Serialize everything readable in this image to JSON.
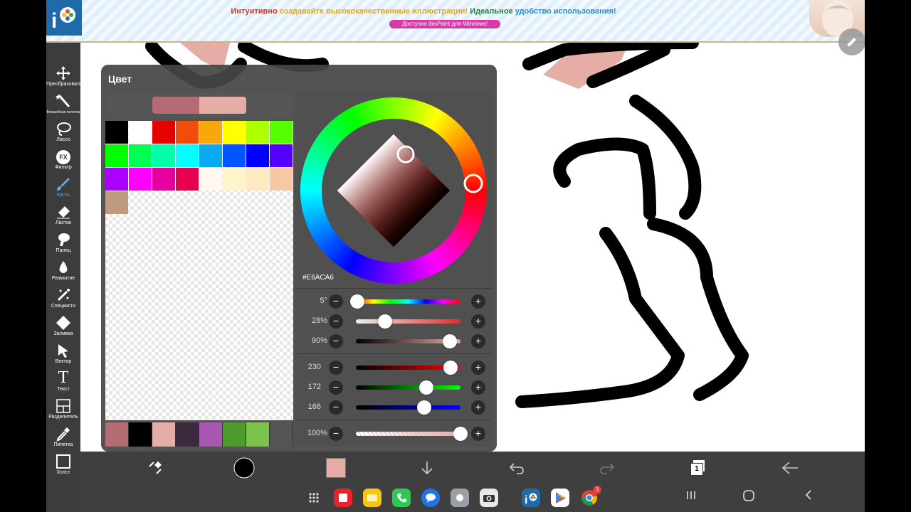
{
  "ad": {
    "line_part1": "Интуитивно",
    "line_part2": "создавайте высококачественные иллюстрации!",
    "line_part3": "Идеальное",
    "line_part4": "удобство использования!",
    "pill": "Доступно ibisPaint для Windows!"
  },
  "toolbar": {
    "items": [
      {
        "label": "Преобразовать",
        "icon": "move-icon"
      },
      {
        "label": "Волшебная палочка",
        "icon": "magic-wand-icon"
      },
      {
        "label": "Лассо",
        "icon": "lasso-icon"
      },
      {
        "label": "Фильтр",
        "icon": "fx-icon"
      },
      {
        "label": "Кисть",
        "icon": "brush-icon"
      },
      {
        "label": "Ластик",
        "icon": "eraser-icon"
      },
      {
        "label": "Палец",
        "icon": "finger-icon"
      },
      {
        "label": "Размытие",
        "icon": "blur-icon"
      },
      {
        "label": "Спецкисти",
        "icon": "special-brush-icon"
      },
      {
        "label": "Заливка",
        "icon": "fill-icon"
      },
      {
        "label": "Вектор",
        "icon": "vector-icon"
      },
      {
        "label": "Текст",
        "icon": "text-icon"
      },
      {
        "label": "Разделитель",
        "icon": "frame-divider-icon"
      },
      {
        "label": "Пипетка",
        "icon": "eyedropper-icon"
      },
      {
        "label": "Холст",
        "icon": "canvas-icon"
      }
    ],
    "active": "Кисть",
    "fx_glyph": "FX",
    "text_glyph": "T"
  },
  "color_panel": {
    "title": "Цвет",
    "current_color": "#B46B72",
    "previous_color": "#E6ACA6",
    "hex": "#E6ACA6",
    "palette": [
      "#000000",
      "#FFFFFF",
      "#E60000",
      "#F04D0A",
      "#F9A70B",
      "#FFFF00",
      "#AEFF00",
      "#55FF00",
      "#00FF00",
      "#00FF55",
      "#00FFAA",
      "#00FFFF",
      "#0AAAF0",
      "#0055FF",
      "#0000FF",
      "#5500FF",
      "#AA00FF",
      "#FF00FF",
      "#E600A0",
      "#E6004D",
      "#FFF8EE",
      "#FFF4CC",
      "#FFEBC2",
      "#F7C8A6",
      "#BF9A7E"
    ],
    "history": [
      "#B46B72",
      "#000000",
      "#E6ACA6",
      "#3C2A3F",
      "#A858B0",
      "#4E9A2A",
      "#7CC34C",
      "#555555"
    ],
    "hsb": [
      {
        "label": "5°",
        "value": 5,
        "max": 360
      },
      {
        "label": "28%",
        "value": 28,
        "max": 100
      },
      {
        "label": "90%",
        "value": 90,
        "max": 100
      }
    ],
    "rgb": [
      {
        "label": "230",
        "value": 230,
        "max": 255
      },
      {
        "label": "172",
        "value": 172,
        "max": 255
      },
      {
        "label": "166",
        "value": 166,
        "max": 255
      }
    ],
    "opacity": {
      "label": "100%",
      "value": 100,
      "max": 100
    }
  },
  "bottom_bar": {
    "icons": [
      "transform-icon",
      "brush-size-icon",
      "color-swatch-icon",
      "download-icon",
      "undo-icon",
      "redo-icon",
      "layers-icon",
      "back-arrow-icon"
    ],
    "layer_count": "1",
    "swatch_color": "#E6ACA6"
  },
  "system_bar": {
    "apps": [
      "app-grid-icon",
      "notes-app-icon",
      "folder-app-icon",
      "phone-app-icon",
      "messages-app-icon",
      "settings-app-icon",
      "camera-app-icon",
      "ibispaint-app-icon",
      "play-store-icon",
      "chrome-app-icon"
    ],
    "chrome_badge": "3",
    "nav": [
      "recents-nav-icon",
      "home-nav-icon",
      "back-nav-icon"
    ]
  }
}
